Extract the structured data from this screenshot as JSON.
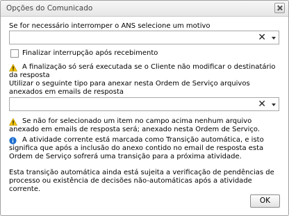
{
  "dialog": {
    "title": "Opções do Comunicado",
    "close_icon": "close-icon"
  },
  "motivo": {
    "label": "Se for necessário interromper o ANS selecione um motivo",
    "value": "",
    "clear_glyph": "✕"
  },
  "finalizar": {
    "label": "Finalizar interrupção após recebimento",
    "checked": false
  },
  "warning1": {
    "icon": "warning-icon",
    "text": "A finalização só será executada se o Cliente não modificar o destinatário da resposta"
  },
  "anexo": {
    "label": "Utilizar o seguinte tipo para anexar nesta Ordem de Serviço arquivos anexados em emails de resposta",
    "value": "",
    "clear_glyph": "✕"
  },
  "warning2": {
    "icon": "warning-icon",
    "text": "Se não for selecionado um item no campo acima nenhum arquivo anexado em emails de resposta será; anexado nesta Ordem de Serviço."
  },
  "info": {
    "icon": "info-icon",
    "text": "A atividade corrente está marcada como Transição automática, e isto significa que após a inclusão do anexo contido no email de resposta esta Ordem de Serviço sofrerá uma transição para a próxima atividade."
  },
  "note": "Esta transição automática ainda está sujeita a verificação de pendências de processo ou existência de decisões não-automáticas após a atividade corrente.",
  "ok_label": "OK",
  "colors": {
    "warning": "#f2c200",
    "info": "#1e6fd0"
  }
}
